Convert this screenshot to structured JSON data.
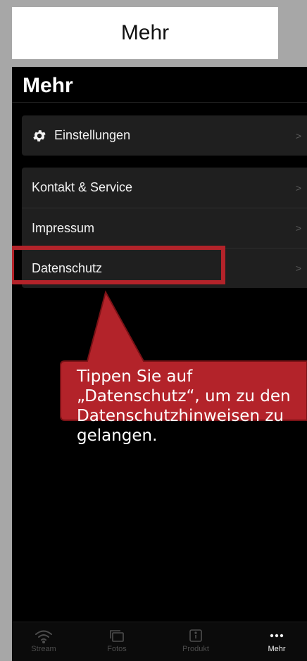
{
  "instruction_title": "Mehr",
  "screen": {
    "title": "Mehr"
  },
  "settings_group": {
    "items": [
      {
        "label": "Einstellungen",
        "icon": "gear-icon"
      }
    ]
  },
  "info_group": {
    "items": [
      {
        "label": "Kontakt & Service"
      },
      {
        "label": "Impressum"
      },
      {
        "label": "Datenschutz"
      }
    ]
  },
  "chevron": ">",
  "callout": {
    "lines": [
      "Tippen Sie auf",
      "„Datenschutz“, um zu den",
      "Datenschutzhinweisen zu",
      "gelangen."
    ],
    "color": "#b3232a"
  },
  "tabbar": {
    "tabs": [
      {
        "label": "Stream",
        "icon": "wifi-icon",
        "active": false
      },
      {
        "label": "Fotos",
        "icon": "photos-icon",
        "active": false
      },
      {
        "label": "Produkt",
        "icon": "info-icon",
        "active": false
      },
      {
        "label": "Mehr",
        "icon": "more-icon",
        "active": true
      }
    ]
  }
}
